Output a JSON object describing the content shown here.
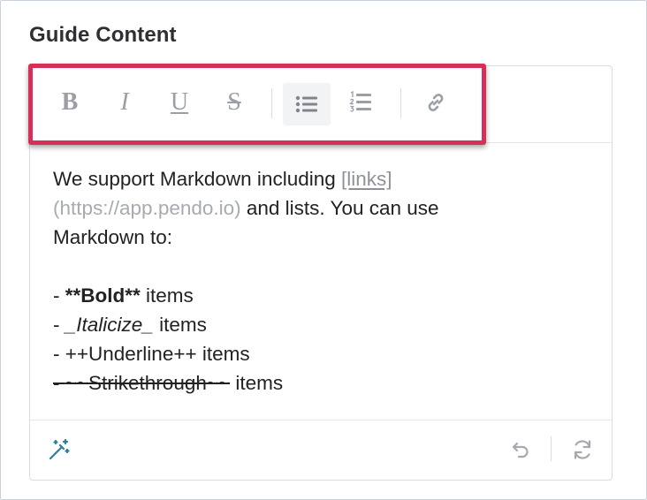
{
  "heading": "Guide Content",
  "toolbar": {
    "bold_label": "B",
    "italic_label": "I",
    "underline_label": "U",
    "strike_label": "S",
    "icons": [
      "bold-icon",
      "italic-icon",
      "underline-icon",
      "strikethrough-icon",
      "bulleted-list-icon",
      "numbered-list-icon",
      "link-icon"
    ]
  },
  "content": {
    "line1_prefix": "We support Markdown including ",
    "line1_link": "[links]",
    "line2_url": "(https://app.pendo.io)",
    "line2_suffix": " and lists. You can use",
    "line3": "Markdown to:",
    "bold_prefix": "- ",
    "bold_text": "**Bold**",
    "bold_suffix": " items",
    "italic_prefix": "- ",
    "italic_text": "_Italicize_",
    "italic_suffix": " items",
    "underline_line": "- ++Underline++ items",
    "strike_prefix": "- ",
    "strike_text": "~~Strikethrough~~",
    "strike_suffix": " items"
  },
  "footer": {
    "icons": [
      "magic-wand-icon",
      "undo-icon",
      "redo-icon"
    ]
  },
  "colors": {
    "highlight_border": "#d6305a",
    "icon_gray": "#9a9ea5",
    "magic_icon": "#2f7f9a"
  }
}
